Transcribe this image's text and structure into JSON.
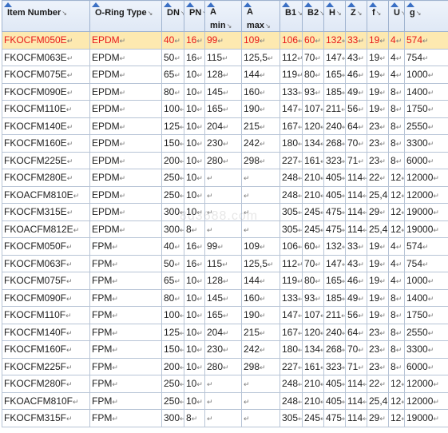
{
  "headers": [
    {
      "lines": [
        "Item Number"
      ]
    },
    {
      "lines": [
        "O-Ring Type"
      ]
    },
    {
      "lines": [
        "DN"
      ]
    },
    {
      "lines": [
        "PN"
      ]
    },
    {
      "lines": [
        "A",
        "min"
      ]
    },
    {
      "lines": [
        "A",
        "max"
      ]
    },
    {
      "lines": [
        "B1"
      ]
    },
    {
      "lines": [
        "B2"
      ]
    },
    {
      "lines": [
        "H"
      ]
    },
    {
      "lines": [
        "Z"
      ]
    },
    {
      "lines": [
        "f"
      ]
    },
    {
      "lines": [
        "U"
      ]
    },
    {
      "lines": [
        "g"
      ]
    }
  ],
  "rows": [
    [
      "FKOCFM050E",
      "EPDM",
      "40",
      "16",
      "99",
      "109",
      "106",
      "60",
      "132",
      "33",
      "19",
      "4",
      "574"
    ],
    [
      "FKOCFM063E",
      "EPDM",
      "50",
      "16",
      "115",
      "125,5",
      "112",
      "70",
      "147",
      "43",
      "19",
      "4",
      "754"
    ],
    [
      "FKOCFM075E",
      "EPDM",
      "65",
      "10",
      "128",
      "144",
      "119",
      "80",
      "165",
      "46",
      "19",
      "4",
      "1000"
    ],
    [
      "FKOCFM090E",
      "EPDM",
      "80",
      "10",
      "145",
      "160",
      "133",
      "93",
      "185",
      "49",
      "19",
      "8",
      "1400"
    ],
    [
      "FKOCFM110E",
      "EPDM",
      "100",
      "10",
      "165",
      "190",
      "147",
      "107",
      "211",
      "56",
      "19",
      "8",
      "1750"
    ],
    [
      "FKOCFM140E",
      "EPDM",
      "125",
      "10",
      "204",
      "215",
      "167",
      "120",
      "240",
      "64",
      "23",
      "8",
      "2550"
    ],
    [
      "FKOCFM160E",
      "EPDM",
      "150",
      "10",
      "230",
      "242",
      "180",
      "134",
      "268",
      "70",
      "23",
      "8",
      "3300"
    ],
    [
      "FKOCFM225E",
      "EPDM",
      "200",
      "10",
      "280",
      "298",
      "227",
      "161",
      "323",
      "71",
      "23",
      "8",
      "6000"
    ],
    [
      "FKOCFM280E",
      "EPDM",
      "250",
      "10",
      "",
      "",
      "248",
      "210",
      "405",
      "114",
      "22",
      "12",
      "12000"
    ],
    [
      "FKOACFM810E",
      "EPDM",
      "250",
      "10",
      "",
      "",
      "248",
      "210",
      "405",
      "114",
      "25,4",
      "12",
      "12000"
    ],
    [
      "FKOCFM315E",
      "EPDM",
      "300",
      "10",
      "",
      "",
      "305",
      "245",
      "475",
      "114",
      "29",
      "12",
      "19000"
    ],
    [
      "FKOACFM812E",
      "EPDM",
      "300",
      "8",
      "",
      "",
      "305",
      "245",
      "475",
      "114",
      "25,4",
      "12",
      "19000"
    ],
    [
      "FKOCFM050F",
      "FPM",
      "40",
      "16",
      "99",
      "109",
      "106",
      "60",
      "132",
      "33",
      "19",
      "4",
      "574"
    ],
    [
      "FKOCFM063F",
      "FPM",
      "50",
      "16",
      "115",
      "125,5",
      "112",
      "70",
      "147",
      "43",
      "19",
      "4",
      "754"
    ],
    [
      "FKOCFM075F",
      "FPM",
      "65",
      "10",
      "128",
      "144",
      "119",
      "80",
      "165",
      "46",
      "19",
      "4",
      "1000"
    ],
    [
      "FKOCFM090F",
      "FPM",
      "80",
      "10",
      "145",
      "160",
      "133",
      "93",
      "185",
      "49",
      "19",
      "8",
      "1400"
    ],
    [
      "FKOCFM110F",
      "FPM",
      "100",
      "10",
      "165",
      "190",
      "147",
      "107",
      "211",
      "56",
      "19",
      "8",
      "1750"
    ],
    [
      "FKOCFM140F",
      "FPM",
      "125",
      "10",
      "204",
      "215",
      "167",
      "120",
      "240",
      "64",
      "23",
      "8",
      "2550"
    ],
    [
      "FKOCFM160F",
      "FPM",
      "150",
      "10",
      "230",
      "242",
      "180",
      "134",
      "268",
      "70",
      "23",
      "8",
      "3300"
    ],
    [
      "FKOCFM225F",
      "FPM",
      "200",
      "10",
      "280",
      "298",
      "227",
      "161",
      "323",
      "71",
      "23",
      "8",
      "6000"
    ],
    [
      "FKOCFM280F",
      "FPM",
      "250",
      "10",
      "",
      "",
      "248",
      "210",
      "405",
      "114",
      "22",
      "12",
      "12000"
    ],
    [
      "FKOACFM810F",
      "FPM",
      "250",
      "10",
      "",
      "",
      "248",
      "210",
      "405",
      "114",
      "25,4",
      "12",
      "12000"
    ],
    [
      "FKOCFM315F",
      "FPM",
      "300",
      "8",
      "",
      "",
      "305",
      "245",
      "475",
      "114",
      "29",
      "12",
      "19000"
    ]
  ],
  "highlight_row": 0,
  "watermark": "8d3688.com",
  "colors": {
    "highlight_bg": "#fde9b0",
    "highlight_text": "#e81818",
    "header_accent": "#3a6fc4"
  }
}
